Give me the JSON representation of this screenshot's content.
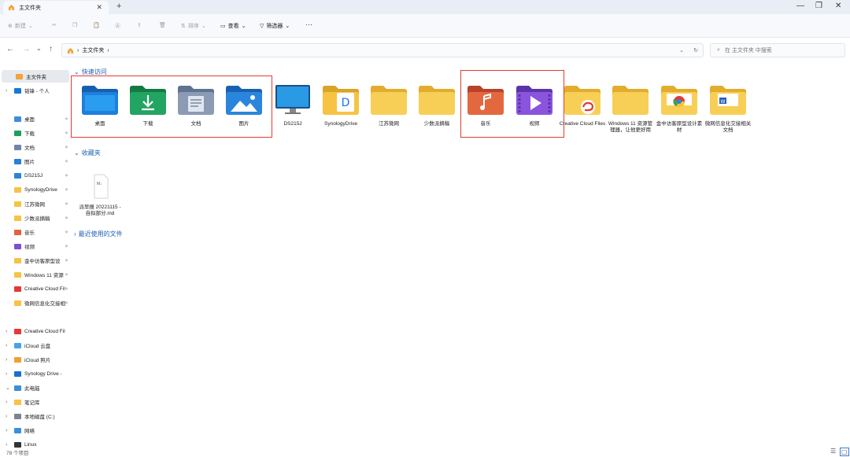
{
  "window": {
    "tab_title": "主文件夹",
    "new_tab": "+",
    "close_tab": "✕",
    "minimize": "—",
    "maximize": "❐",
    "close": "✕"
  },
  "toolbar": {
    "new_label": "新建",
    "sort_label": "排序",
    "view_label": "查看",
    "filter_label": "筛选器",
    "more": "···"
  },
  "address": {
    "path": "主文件夹",
    "search_placeholder": "在 主文件夹 中搜索"
  },
  "sidebar": {
    "items": [
      {
        "label": "主文件夹",
        "color": "#f2a33a"
      },
      {
        "label": "韬锋 - 个人",
        "color": "#1677d8"
      },
      {
        "label": "桌面",
        "color": "#3b8fd9"
      },
      {
        "label": "下载",
        "color": "#1f9e5a"
      },
      {
        "label": "文档",
        "color": "#6f86a6"
      },
      {
        "label": "图片",
        "color": "#2a7fd6"
      },
      {
        "label": "DS215J",
        "color": "#2a85d0"
      },
      {
        "label": "SynologyDrive",
        "color": "#f6c344"
      },
      {
        "label": "江苏微网",
        "color": "#f6c344"
      },
      {
        "label": "少数派摘稿",
        "color": "#f6c344"
      },
      {
        "label": "音乐",
        "color": "#e0623e"
      },
      {
        "label": "视频",
        "color": "#7d4fd4"
      },
      {
        "label": "金中访客原型设",
        "color": "#f6c344"
      },
      {
        "label": "Windows 11 资源",
        "color": "#f6c344"
      },
      {
        "label": "Creative Cloud Fil",
        "color": "#e53935"
      },
      {
        "label": "微网信息化交接相",
        "color": "#f6c344"
      },
      {
        "label": "Creative Cloud Fil",
        "color": "#e53935"
      },
      {
        "label": "iCloud 云盘",
        "color": "#4aa3e8"
      },
      {
        "label": "iCloud 照片",
        "color": "#f0a030"
      },
      {
        "label": "Synology Drive -",
        "color": "#1a6ed0"
      },
      {
        "label": "此电脑",
        "color": "#3b8fd9"
      },
      {
        "label": "笔记库",
        "color": "#f6c344"
      },
      {
        "label": "本地磁盘 (C:)",
        "color": "#7a8591"
      },
      {
        "label": "网络",
        "color": "#3b8fd9"
      },
      {
        "label": "Linux",
        "color": "#333333"
      }
    ]
  },
  "main": {
    "quick_access_label": "快速访问",
    "favorites_label": "收藏夹",
    "recent_label": "最近使用的文件",
    "quick_items": [
      {
        "label": "桌面",
        "icon": "desktop-folder-icon"
      },
      {
        "label": "下载",
        "icon": "download-folder-icon"
      },
      {
        "label": "文档",
        "icon": "documents-folder-icon"
      },
      {
        "label": "图片",
        "icon": "pictures-folder-icon"
      },
      {
        "label": "DS215J",
        "icon": "monitor-icon"
      },
      {
        "label": "SynologyDrive",
        "icon": "synology-folder-icon"
      },
      {
        "label": "江苏微网",
        "icon": "folder-icon"
      },
      {
        "label": "少数派摘稿",
        "icon": "folder-icon"
      },
      {
        "label": "音乐",
        "icon": "music-folder-icon"
      },
      {
        "label": "视频",
        "icon": "video-folder-icon"
      },
      {
        "label": "Creative Cloud Files",
        "icon": "creative-cloud-folder-icon"
      },
      {
        "label": "Windows 11 资源管理器，让他更好用",
        "icon": "folder-icon"
      },
      {
        "label": "金中访客原型设计素材",
        "icon": "chrome-folder-icon"
      },
      {
        "label": "微网信息化交接相关文档",
        "icon": "word-folder-icon"
      }
    ],
    "favorite_items": [
      {
        "label": "派早报 20221115 - 自拟部分.md",
        "icon": "markdown-file-icon",
        "ext": "M↓"
      }
    ]
  },
  "status": {
    "count": "78 个项目"
  }
}
